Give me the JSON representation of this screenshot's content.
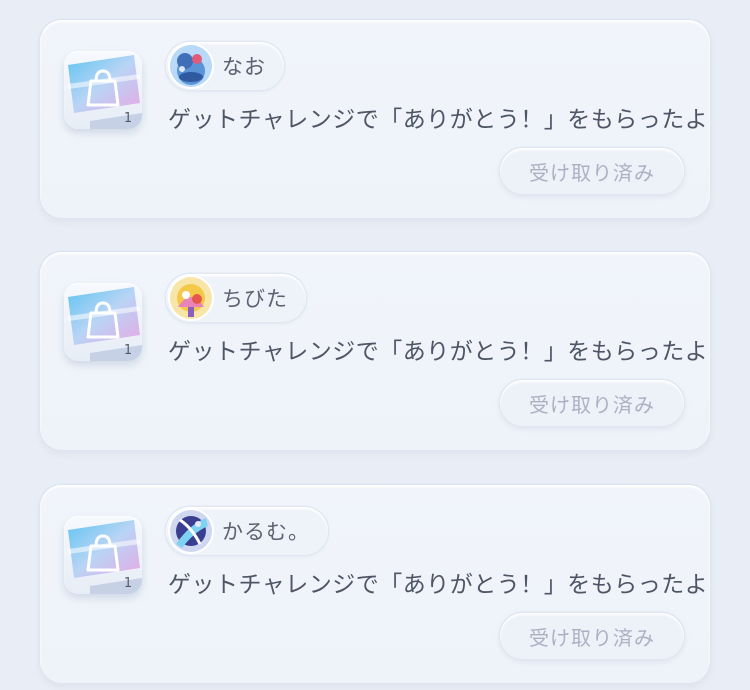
{
  "notifications": [
    {
      "user_name": "なお",
      "avatar_icon": "trainer-avatar-blue-icon",
      "item_icon": "shopping-bag-ticket-icon",
      "item_count": "1",
      "message": "ゲットチャレンジで「ありがとう！」をもらったよ",
      "status_button": "受け取り済み"
    },
    {
      "user_name": "ちびた",
      "avatar_icon": "trainer-avatar-yellow-icon",
      "item_icon": "shopping-bag-ticket-icon",
      "item_count": "1",
      "message": "ゲットチャレンジで「ありがとう！」をもらったよ",
      "status_button": "受け取り済み"
    },
    {
      "user_name": "かるむ。",
      "avatar_icon": "trainer-avatar-purple-icon",
      "item_icon": "shopping-bag-ticket-icon",
      "item_count": "1",
      "message": "ゲットチャレンジで「ありがとう！」をもらったよ",
      "status_button": "受け取り済み"
    }
  ],
  "colors": {
    "background": "#e9eef6",
    "card": "#eff3f9",
    "text": "#4e5565",
    "disabled_text": "#a9b1c3"
  }
}
